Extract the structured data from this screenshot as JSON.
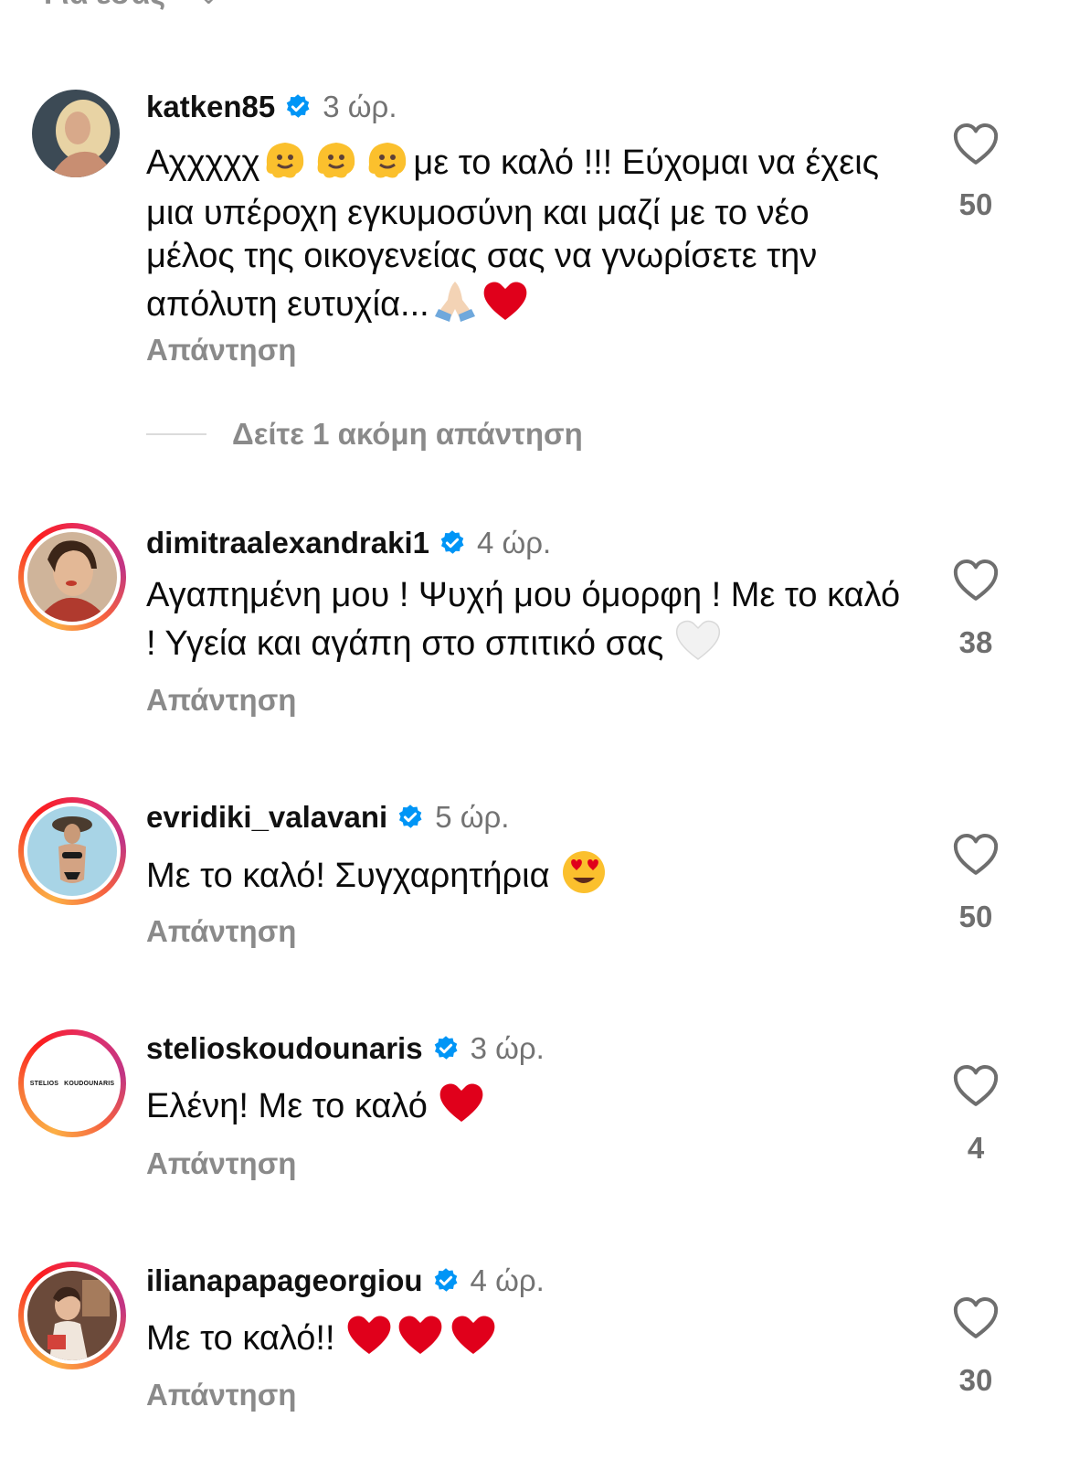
{
  "top_partial": {
    "label": "Για εσάς"
  },
  "comments": [
    {
      "username": "katken85",
      "time": "3 ώρ.",
      "text_a": "Αχχχχχ",
      "text_b": "με το καλό !!! Εύχομαι να έχεις μια υπέροχη εγκυμοσύνη και μαζί με το νέο μέλος της οικογενείας σας να γνωρίσετε την απόλυτη ευτυχία...",
      "reply_label": "Απάντηση",
      "likes": "50"
    },
    {
      "username": "dimitraalexandraki1",
      "time": "4 ώρ.",
      "text": "Αγαπημένη μου ! Ψυχή μου όμορφη ! Με το καλό ! Υγεία και αγάπη στο σπιτικό σας",
      "reply_label": "Απάντηση",
      "likes": "38"
    },
    {
      "username": "evridiki_valavani",
      "time": "5 ώρ.",
      "text": "Με το καλό! Συγχαρητήρια",
      "reply_label": "Απάντηση",
      "likes": "50"
    },
    {
      "username": "stelioskoudounaris",
      "time": "3 ώρ.",
      "text": "Ελένη! Με το καλό",
      "reply_label": "Απάντηση",
      "likes": "4",
      "avatar_text_left": "STELIOS",
      "avatar_text_right": "KOUDOUNARIS"
    },
    {
      "username": "ilianapapageorgiou",
      "time": "4 ώρ.",
      "text": "Με το καλό!!",
      "reply_label": "Απάντηση",
      "likes": "30"
    }
  ],
  "more_replies_label": "Δείτε 1 ακόμη απάντηση",
  "icons": {
    "verified": "verified-badge-icon",
    "like": "heart-outline-icon",
    "chevron": "chevron-down-icon"
  },
  "colors": {
    "verified": "#0095f6",
    "heart_red": "#e0001b",
    "secondary_text": "#8a8a8a"
  }
}
